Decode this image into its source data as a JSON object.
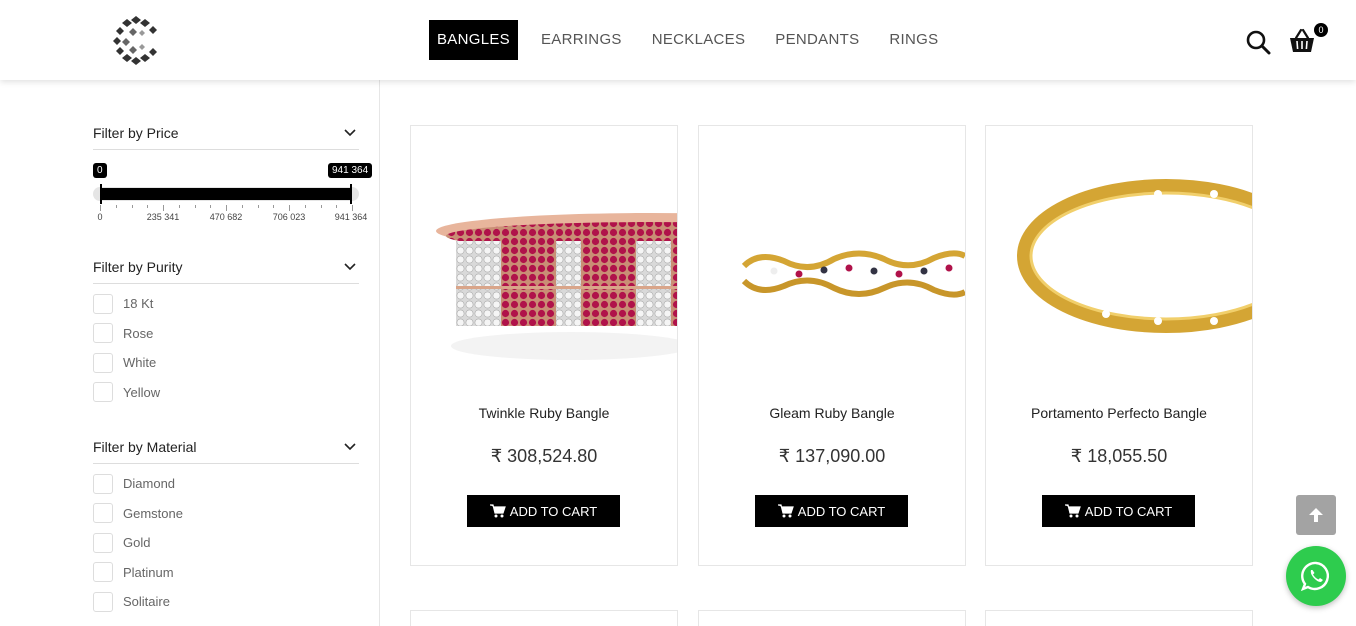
{
  "brand": {
    "logo_icon": "diamond-c-logo"
  },
  "nav": [
    {
      "label": "BANGLES",
      "active": true
    },
    {
      "label": "EARRINGS",
      "active": false
    },
    {
      "label": "NECKLACES",
      "active": false
    },
    {
      "label": "PENDANTS",
      "active": false
    },
    {
      "label": "RINGS",
      "active": false
    }
  ],
  "header_icons": {
    "search": "search-icon",
    "cart": "basket-icon",
    "cart_count": "0"
  },
  "filters": {
    "price": {
      "title": "Filter by Price",
      "min_value": "0",
      "max_value": "941 364",
      "selected_min_fraction": 0,
      "selected_max_fraction": 1,
      "tick_labels": [
        "0",
        "235 341",
        "470 682",
        "706 023",
        "941 364"
      ]
    },
    "purity": {
      "title": "Filter by Purity",
      "options": [
        "18 Kt",
        "Rose",
        "White",
        "Yellow"
      ]
    },
    "material": {
      "title": "Filter by Material",
      "options": [
        "Diamond",
        "Gemstone",
        "Gold",
        "Platinum",
        "Solitaire"
      ]
    }
  },
  "products": [
    {
      "name": "Twinkle Ruby Bangle",
      "price": "₹ 308,524.80",
      "button": "ADD TO CART"
    },
    {
      "name": "Gleam Ruby Bangle",
      "price": "₹ 137,090.00",
      "button": "ADD TO CART"
    },
    {
      "name": "Portamento Perfecto Bangle",
      "price": "₹ 18,055.50",
      "button": "ADD TO CART"
    }
  ],
  "floating": {
    "scroll_top": "arrow-up-icon",
    "chat": "whatsapp-icon"
  },
  "colors": {
    "primary": "#000000",
    "whatsapp": "#2ecc4e",
    "scroll_button": "#a3a3a3",
    "gold": "#d4a534",
    "ruby": "#b0124a"
  }
}
